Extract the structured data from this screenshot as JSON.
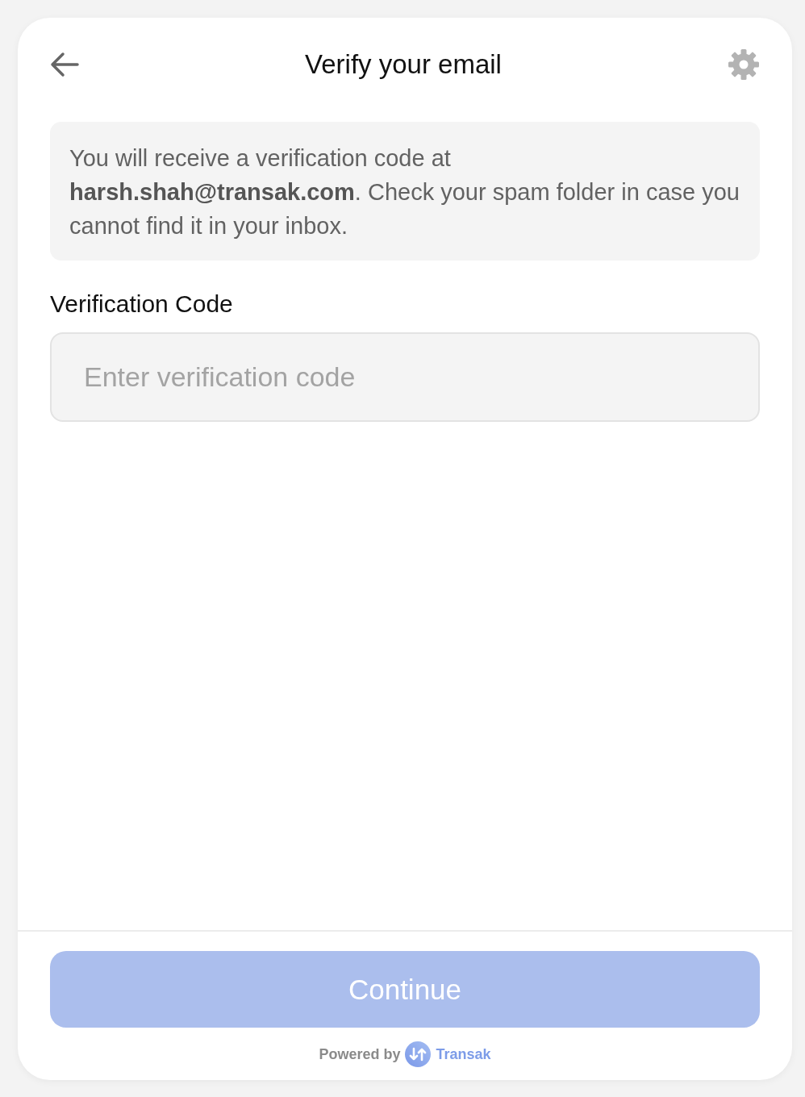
{
  "header": {
    "title": "Verify your email"
  },
  "notice": {
    "text": "You will receive a verification code at **harsh.shah@transak.com**. Check your spam folder in case you cannot find it in your inbox."
  },
  "verification_code": {
    "label": "Verification Code",
    "placeholder": "Enter verification code"
  },
  "continue_button": {
    "label": "Continue",
    "disabled": true
  },
  "footer": {
    "powered_by": "Powered by",
    "brand": "Transak"
  }
}
